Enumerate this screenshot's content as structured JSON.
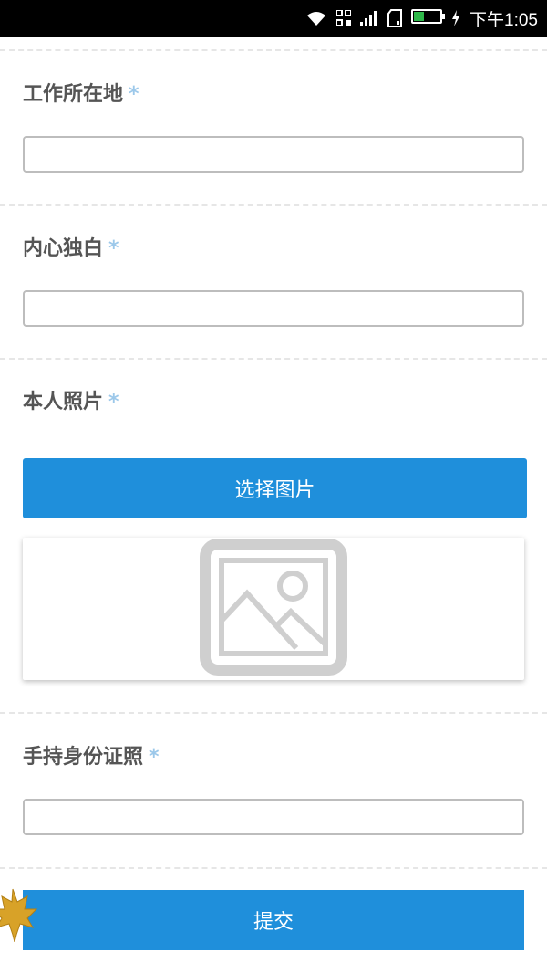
{
  "status_bar": {
    "time": "下午1:05",
    "battery_level": 0.35,
    "icons": [
      "wifi-icon",
      "qr-icon",
      "signal-icon",
      "sim-icon",
      "battery-icon",
      "charging-icon"
    ]
  },
  "form": {
    "required_mark": "*",
    "fields": [
      {
        "label": "工作所在地",
        "value": "",
        "type": "text"
      },
      {
        "label": "内心独白",
        "value": "",
        "type": "text"
      },
      {
        "label": "本人照片",
        "type": "image"
      },
      {
        "label": "手持身份证照",
        "value": "",
        "type": "text"
      }
    ],
    "choose_image_label": "选择图片",
    "submit_label": "提交"
  },
  "colors": {
    "accent": "#1f8fdb",
    "required_mark": "#9cc8ea",
    "label_text": "#555555",
    "input_border": "#bdbdbd",
    "battery": "#2fb84a"
  }
}
